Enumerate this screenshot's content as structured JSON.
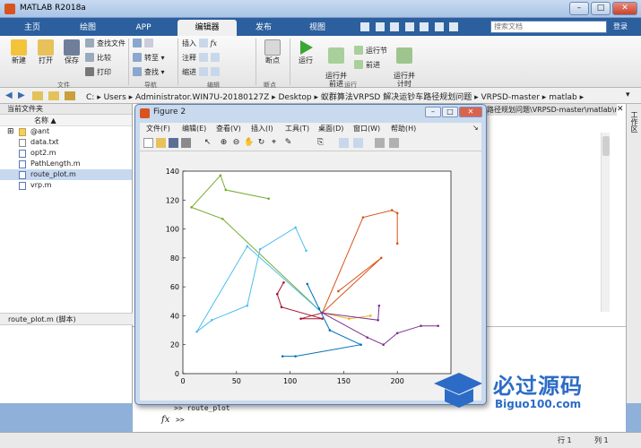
{
  "app": {
    "title": "MATLAB R2018a",
    "min": "–",
    "max": "□",
    "close": "✕"
  },
  "tabs": [
    {
      "label": "主页"
    },
    {
      "label": "绘图"
    },
    {
      "label": "APP"
    },
    {
      "label": "编辑器"
    },
    {
      "label": "发布"
    },
    {
      "label": "视图"
    }
  ],
  "search": {
    "placeholder": "搜索文档",
    "login": "登录"
  },
  "ribbon": {
    "file": {
      "new": "新建",
      "open": "打开",
      "save": "保存",
      "find_files": "查找文件",
      "compare": "比较",
      "print": "打印",
      "group": "文件"
    },
    "navigate": {
      "goto": "转至",
      "find": "查找",
      "group": "导航"
    },
    "edit": {
      "insert": "插入",
      "comment": "注释",
      "indent": "缩进",
      "fx": "fx",
      "group": "编辑"
    },
    "breakpoints": {
      "label": "断点",
      "group": "断点"
    },
    "run": {
      "run": "运行",
      "run_advance": "运行并\n前进",
      "run_section": "运行节",
      "advance": "前进",
      "run_time": "运行并\n计时",
      "group": "运行"
    }
  },
  "path": {
    "crumbs": [
      "C:",
      "Users",
      "Administrator.WIN7U-20180127Z",
      "Desktop",
      "蚁群算法VRPSD 解决运钞车路径规划问题",
      "VRPSD-master",
      "matlab"
    ]
  },
  "current_folder": {
    "title": "当前文件夹",
    "column": "名称 ▲",
    "items": [
      {
        "name": "@ant",
        "type": "folder"
      },
      {
        "name": "data.txt",
        "type": "txt"
      },
      {
        "name": "opt2.m",
        "type": "m"
      },
      {
        "name": "PathLength.m",
        "type": "m"
      },
      {
        "name": "route_plot.m",
        "type": "m",
        "selected": true
      },
      {
        "name": "vrp.m",
        "type": "m"
      }
    ],
    "details": "route_plot.m  (脚本)"
  },
  "editor_tab": "路径规划问题\\VRPSD-master\\matlab\\route_plot.m",
  "workspace_label": "工作区",
  "command": {
    "history": ">> route_plot",
    "prompt": ">>"
  },
  "status": {
    "row": "行 1",
    "col": "列 1"
  },
  "figure": {
    "title": "Figure 2",
    "menu": [
      "文件(F)",
      "编辑(E)",
      "查看(V)",
      "插入(I)",
      "工具(T)",
      "桌面(D)",
      "窗口(W)",
      "帮助(H)"
    ]
  },
  "watermark": {
    "text": "必过源码",
    "url": "Biguo100.com"
  },
  "chart_data": {
    "type": "line",
    "title": "",
    "xlabel": "",
    "ylabel": "",
    "xlim": [
      0,
      250
    ],
    "ylim": [
      0,
      140
    ],
    "xticks": [
      0,
      50,
      100,
      150,
      200
    ],
    "yticks": [
      0,
      20,
      40,
      60,
      80,
      100,
      120,
      140
    ],
    "grid": false,
    "depot": [
      130,
      42
    ],
    "series": [
      {
        "color": "#77ac30",
        "x": [
          130,
          37,
          8,
          35,
          40,
          80
        ],
        "y": [
          42,
          107,
          115,
          137,
          127,
          121
        ]
      },
      {
        "color": "#4dbeee",
        "x": [
          130,
          60,
          13,
          27,
          60,
          72,
          105,
          115
        ],
        "y": [
          42,
          88,
          29,
          37,
          47,
          86,
          101,
          85
        ]
      },
      {
        "color": "#d95319",
        "x": [
          130,
          168,
          195,
          200,
          200
        ],
        "y": [
          42,
          108,
          113,
          111,
          90
        ]
      },
      {
        "color": "#d95319",
        "x": [
          130,
          185,
          145
        ],
        "y": [
          42,
          80,
          57
        ]
      },
      {
        "color": "#0072bd",
        "x": [
          116,
          127,
          137,
          166,
          105,
          93
        ],
        "y": [
          62,
          45,
          30,
          20,
          12,
          12
        ]
      },
      {
        "color": "#7e2f8e",
        "x": [
          130,
          172,
          187,
          200,
          222,
          238
        ],
        "y": [
          42,
          25,
          20,
          28,
          33,
          33
        ]
      },
      {
        "color": "#a2142f",
        "x": [
          130,
          110,
          130,
          92,
          88,
          94
        ],
        "y": [
          42,
          38,
          38,
          46,
          55,
          63
        ]
      },
      {
        "color": "#edb120",
        "x": [
          130,
          155,
          175
        ],
        "y": [
          42,
          38,
          40
        ]
      },
      {
        "color": "#7e2f8e",
        "x": [
          130,
          182,
          183
        ],
        "y": [
          42,
          37,
          47
        ]
      }
    ]
  }
}
